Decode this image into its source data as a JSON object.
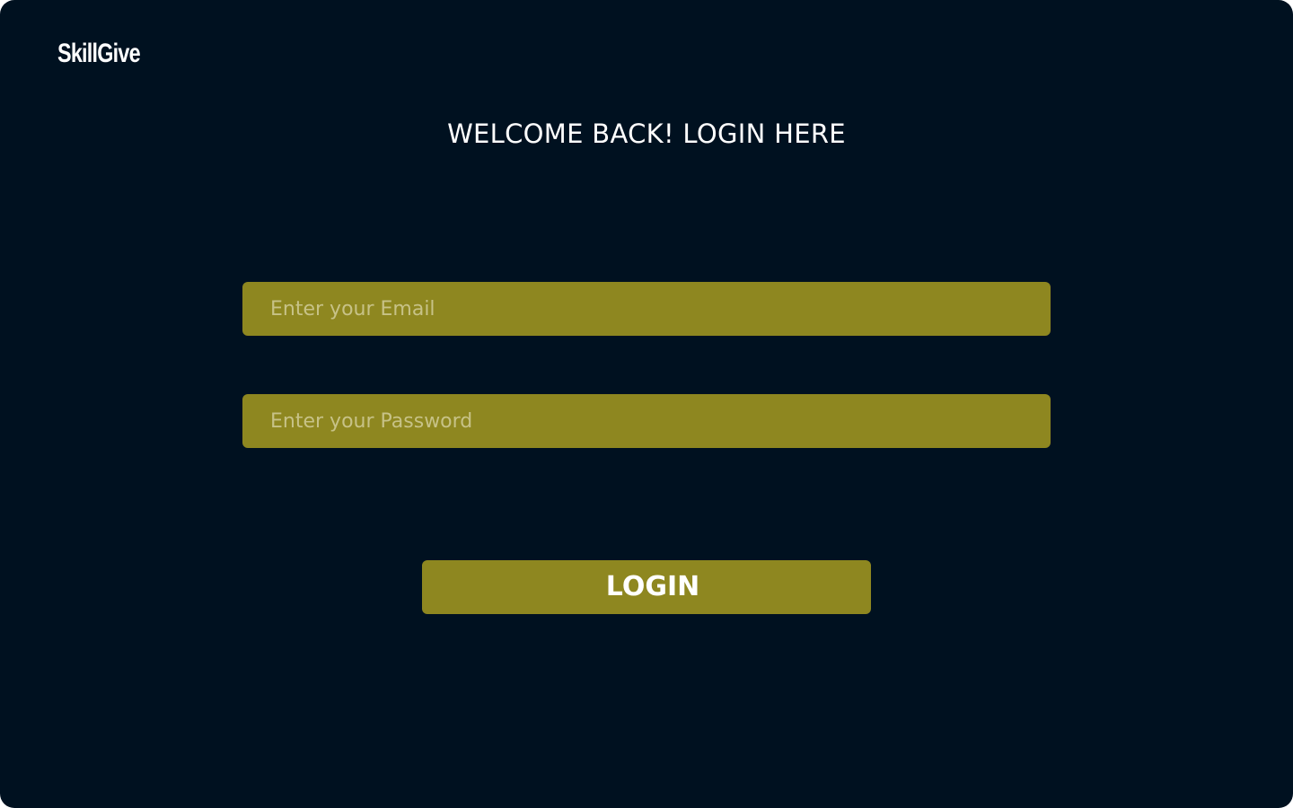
{
  "brand": {
    "name": "SkillGive"
  },
  "page": {
    "title": "WELCOME BACK! LOGIN HERE"
  },
  "form": {
    "email": {
      "value": "",
      "placeholder": "Enter your Email"
    },
    "password": {
      "value": "",
      "placeholder": "Enter your Password"
    },
    "login_label": "LOGIN"
  },
  "colors": {
    "background": "#001120",
    "accent": "#8e8720",
    "text": "#ffffff",
    "placeholder": "#c7c287"
  }
}
